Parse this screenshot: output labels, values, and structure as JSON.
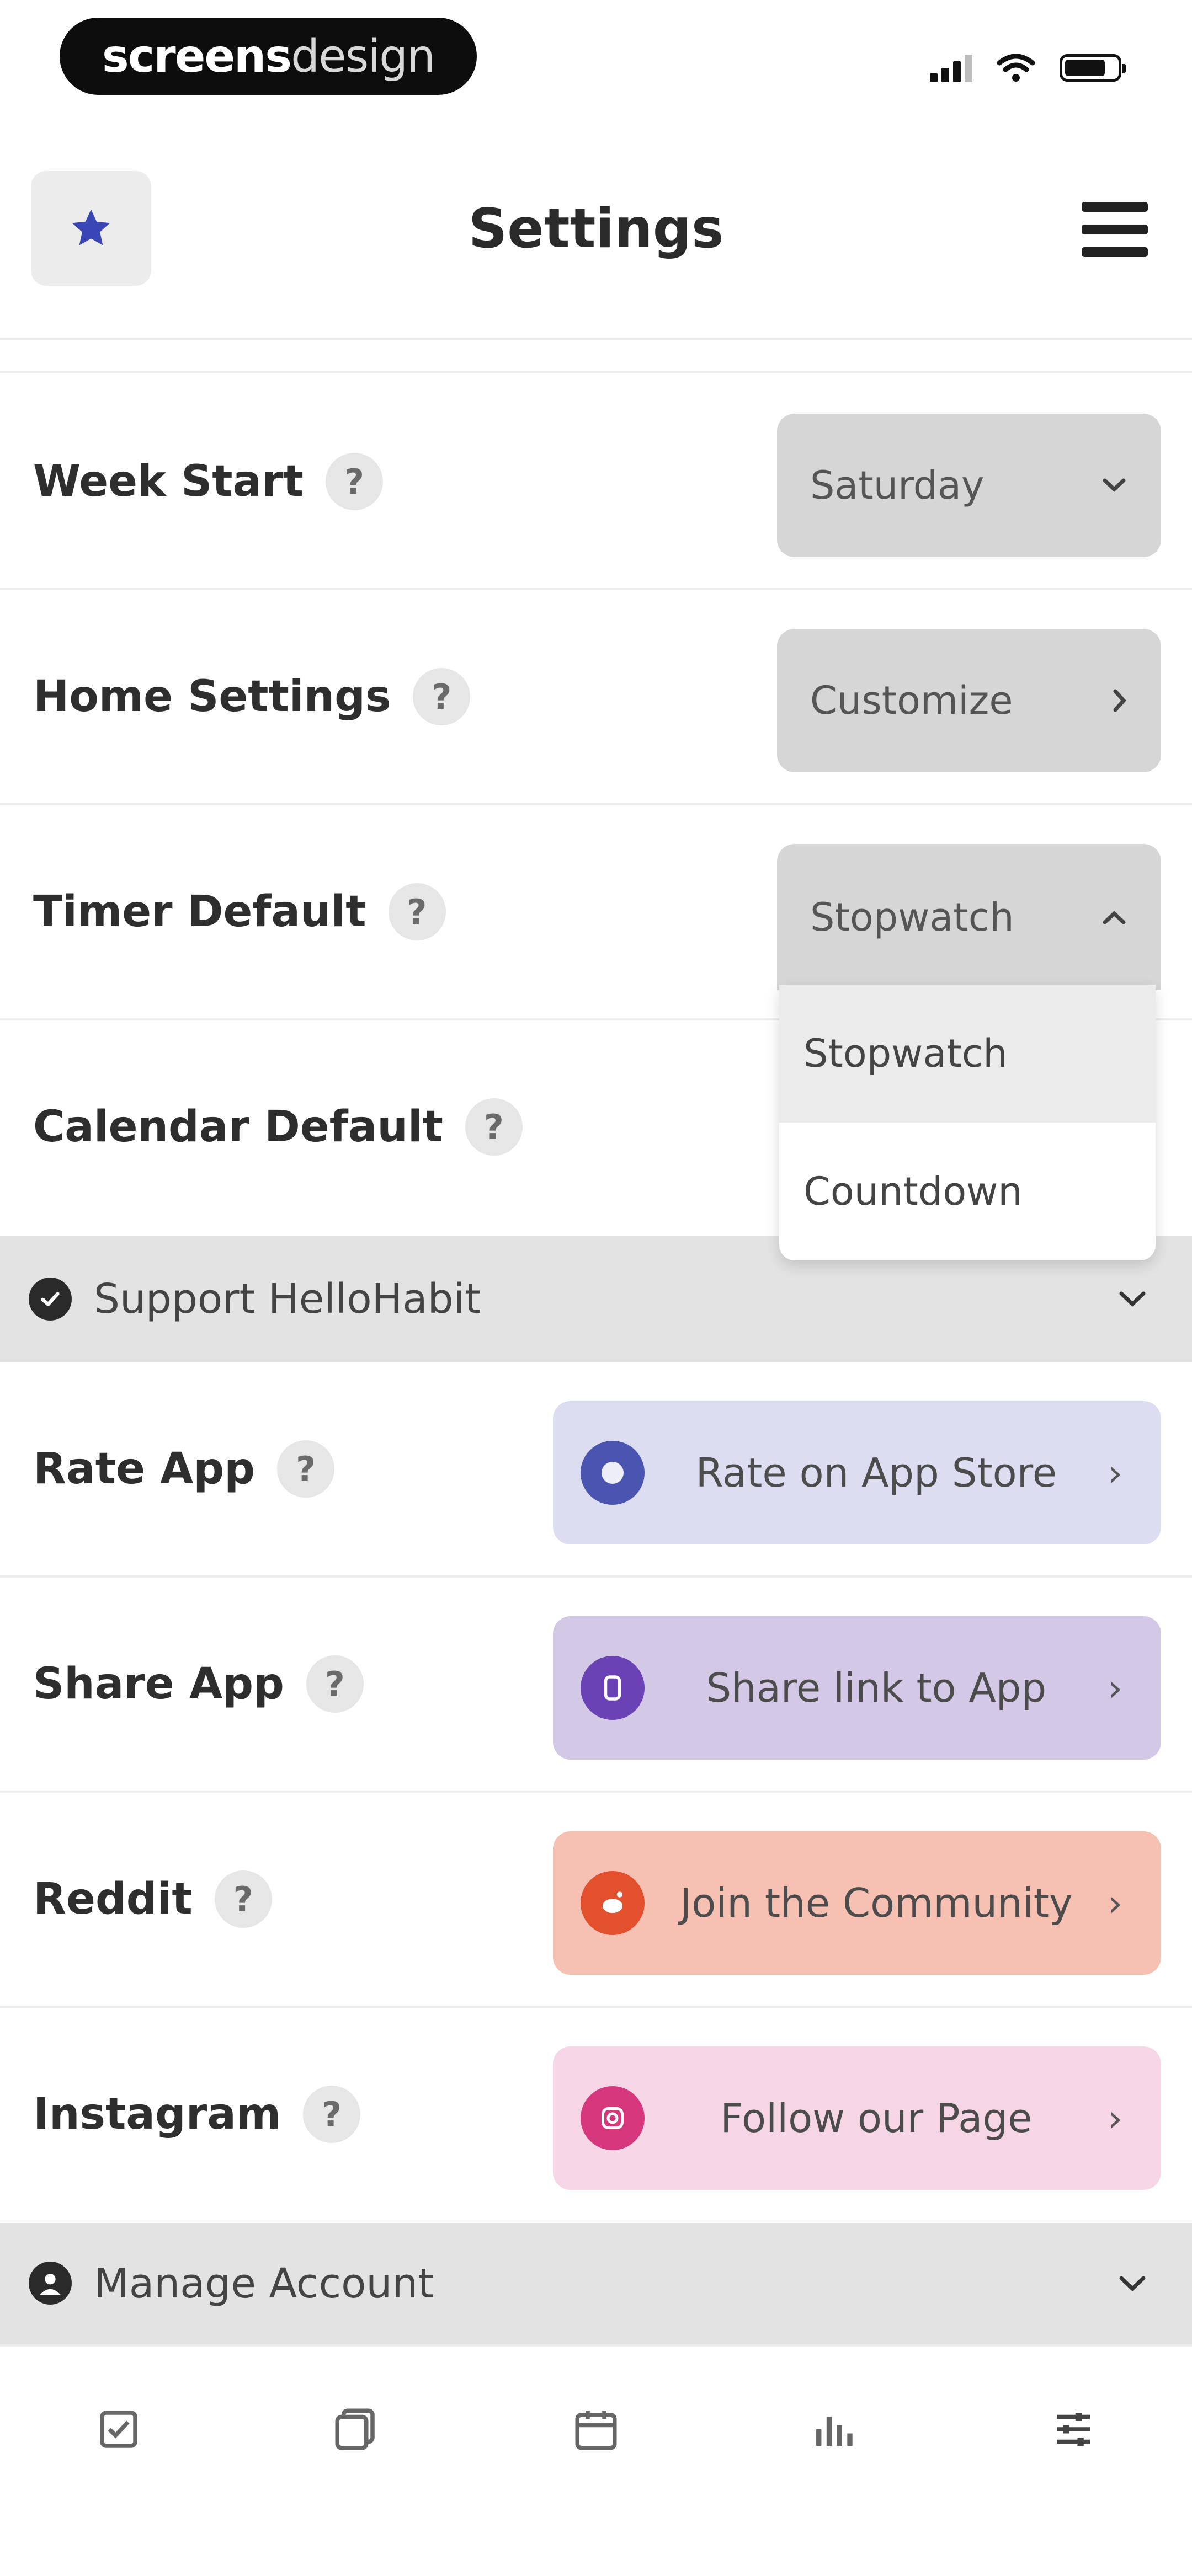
{
  "statusbar": {
    "brand_bold": "screens",
    "brand_light": "design"
  },
  "header": {
    "title": "Settings",
    "favorite_icon": "star-icon",
    "menu_icon": "hamburger-menu-icon"
  },
  "settings_rows": [
    {
      "label": "Week Start",
      "control": "Saturday",
      "control_type": "select"
    },
    {
      "label": "Home Settings",
      "control": "Customize",
      "control_type": "link"
    },
    {
      "label": "Timer Default",
      "control": "Stopwatch",
      "control_type": "select-open"
    },
    {
      "label": "Calendar Default"
    }
  ],
  "timer_dropdown": {
    "options": [
      "Stopwatch",
      "Countdown"
    ],
    "selected": "Stopwatch"
  },
  "support_section": {
    "title": "Support HelloHabit"
  },
  "support_rows": [
    {
      "label": "Rate App",
      "button": "Rate on App Store",
      "color": "#dcddf1",
      "icon_color": "#4a55b0",
      "icon": "app-store-icon"
    },
    {
      "label": "Share App",
      "button": "Share link to App",
      "color": "#d3c8e6",
      "icon_color": "#6a42b5",
      "icon": "share-icon"
    },
    {
      "label": "Reddit",
      "button": "Join the Community",
      "color": "#f6c0b3",
      "icon_color": "#e3502d",
      "icon": "reddit-icon"
    },
    {
      "label": "Instagram",
      "button": "Follow our Page",
      "color": "#f6d6e5",
      "icon_color": "#d6367b",
      "icon": "instagram-icon"
    }
  ],
  "account_section": {
    "title": "Manage Account"
  },
  "bottom_nav": [
    "checklist-icon",
    "journal-icon",
    "calendar-icon",
    "stats-icon",
    "settings-sliders-icon"
  ],
  "help_glyph": "?",
  "colors": {
    "accent_star": "#3b46b5",
    "select_bg": "#d6d6d6",
    "section_bg": "#e3e3e3"
  }
}
